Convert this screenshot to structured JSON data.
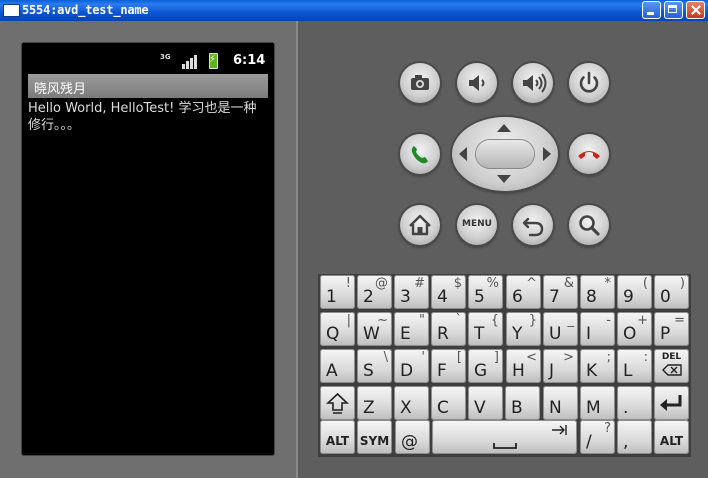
{
  "window": {
    "title": "5554:avd_test_name"
  },
  "device": {
    "status": {
      "network": "3G",
      "time": "6:14"
    },
    "app": {
      "title": "晓风残月",
      "content": "Hello World, HelloTest! 学习也是一种修行。。。"
    }
  },
  "controls": {
    "menu_label": "MENU"
  },
  "keyboard": {
    "rows": [
      [
        {
          "p": "1",
          "s": "!"
        },
        {
          "p": "2",
          "s": "@"
        },
        {
          "p": "3",
          "s": "#"
        },
        {
          "p": "4",
          "s": "$"
        },
        {
          "p": "5",
          "s": "%"
        },
        {
          "p": "6",
          "s": "^"
        },
        {
          "p": "7",
          "s": "&"
        },
        {
          "p": "8",
          "s": "*"
        },
        {
          "p": "9",
          "s": "("
        },
        {
          "p": "0",
          "s": ")"
        }
      ],
      [
        {
          "p": "Q",
          "s": "|"
        },
        {
          "p": "W",
          "s": "~"
        },
        {
          "p": "E",
          "s": "\""
        },
        {
          "p": "R",
          "s": "`"
        },
        {
          "p": "T",
          "s": "{"
        },
        {
          "p": "Y",
          "s": "}"
        },
        {
          "p": "U",
          "s": "_"
        },
        {
          "p": "I",
          "s": "-"
        },
        {
          "p": "O",
          "s": "+"
        },
        {
          "p": "P",
          "s": "="
        }
      ],
      [
        {
          "p": "A",
          "s": ""
        },
        {
          "p": "S",
          "s": "\\"
        },
        {
          "p": "D",
          "s": "'"
        },
        {
          "p": "F",
          "s": "["
        },
        {
          "p": "G",
          "s": "]"
        },
        {
          "p": "H",
          "s": "<"
        },
        {
          "p": "J",
          "s": ">"
        },
        {
          "p": "K",
          "s": ";"
        },
        {
          "p": "L",
          "s": ":"
        }
      ]
    ],
    "del_label": "DEL",
    "row4": [
      "Z",
      "X",
      "C",
      "V",
      "B",
      "N",
      "M",
      "."
    ],
    "alt_label": "ALT",
    "sym_label": "SYM",
    "at_label": "@",
    "slash_p": "/",
    "slash_s": "?",
    "comma_label": ","
  }
}
